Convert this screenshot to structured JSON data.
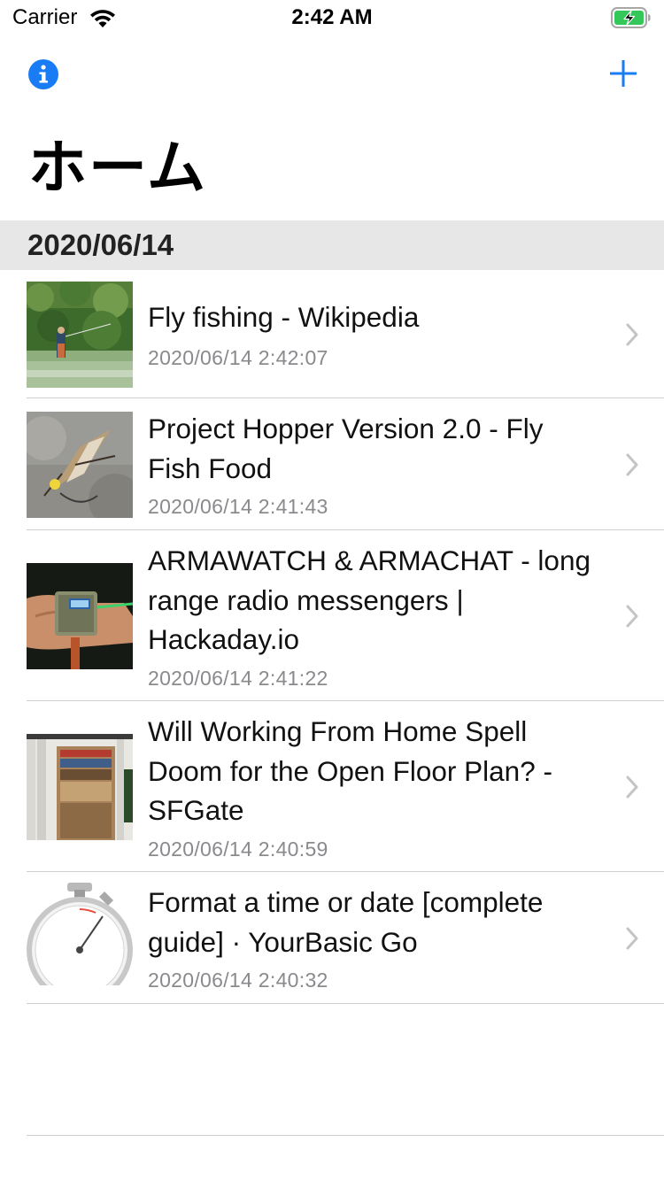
{
  "status_bar": {
    "carrier": "Carrier",
    "time": "2:42 AM",
    "battery_state": "charging"
  },
  "nav": {
    "info_icon": "info-circle-icon",
    "add_icon": "plus-icon",
    "accent_color": "#1a7cf5",
    "title": "ホーム"
  },
  "section": {
    "header": "2020/06/14"
  },
  "items": [
    {
      "title": "Fly fishing - Wikipedia",
      "date": "2020/06/14 2:42:07",
      "thumbnail": "fly-fishing-river-photo"
    },
    {
      "title": "Project Hopper Version 2.0 - Fly Fish Food",
      "date": "2020/06/14 2:41:43",
      "thumbnail": "fly-lure-photo"
    },
    {
      "title": "ARMAWATCH & ARMACHAT - long range radio messengers | Hackaday.io",
      "date": "2020/06/14 2:41:22",
      "thumbnail": "radio-device-in-hand-photo"
    },
    {
      "title": "Will Working From Home Spell Doom for the Open Floor Plan? - SFGate",
      "date": "2020/06/14 2:40:59",
      "thumbnail": "office-bookshelf-photo"
    },
    {
      "title": "Format a time or date [complete guide] · YourBasic Go",
      "date": "2020/06/14 2:40:32",
      "thumbnail": "stopwatch-image"
    }
  ]
}
